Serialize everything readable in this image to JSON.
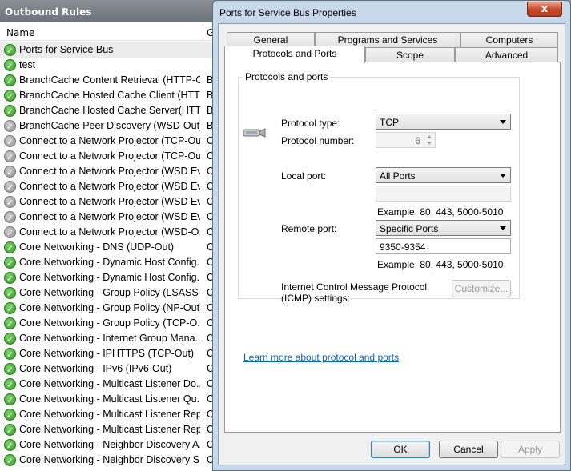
{
  "background": {
    "header_title": "Outbound Rules",
    "columns": {
      "name": "Name",
      "group": "G"
    },
    "rows": [
      {
        "name": "Ports for Service Bus",
        "group": "",
        "enabled": true
      },
      {
        "name": "test",
        "group": "",
        "enabled": true
      },
      {
        "name": "BranchCache Content Retrieval (HTTP-O...",
        "group": "B",
        "enabled": true
      },
      {
        "name": "BranchCache Hosted Cache Client (HTTT...",
        "group": "B",
        "enabled": true
      },
      {
        "name": "BranchCache Hosted Cache Server(HTTP...",
        "group": "B",
        "enabled": true
      },
      {
        "name": "BranchCache Peer Discovery (WSD-Out)",
        "group": "B",
        "enabled": false
      },
      {
        "name": "Connect to a Network Projector (TCP-Out)",
        "group": "C",
        "enabled": false
      },
      {
        "name": "Connect to a Network Projector (TCP-Out)",
        "group": "C",
        "enabled": false
      },
      {
        "name": "Connect to a Network Projector (WSD Ev...",
        "group": "C",
        "enabled": false
      },
      {
        "name": "Connect to a Network Projector (WSD Ev...",
        "group": "C",
        "enabled": false
      },
      {
        "name": "Connect to a Network Projector (WSD Ev...",
        "group": "C",
        "enabled": false
      },
      {
        "name": "Connect to a Network Projector (WSD Ev...",
        "group": "C",
        "enabled": false
      },
      {
        "name": "Connect to a Network Projector (WSD-O...",
        "group": "C",
        "enabled": false
      },
      {
        "name": "Core Networking - DNS (UDP-Out)",
        "group": "C",
        "enabled": true
      },
      {
        "name": "Core Networking - Dynamic Host Config...",
        "group": "C",
        "enabled": true
      },
      {
        "name": "Core Networking - Dynamic Host Config...",
        "group": "C",
        "enabled": true
      },
      {
        "name": "Core Networking - Group Policy (LSASS-...",
        "group": "C",
        "enabled": true
      },
      {
        "name": "Core Networking - Group Policy (NP-Out)",
        "group": "C",
        "enabled": true
      },
      {
        "name": "Core Networking - Group Policy (TCP-O...",
        "group": "C",
        "enabled": true
      },
      {
        "name": "Core Networking - Internet Group Mana...",
        "group": "C",
        "enabled": true
      },
      {
        "name": "Core Networking - IPHTTPS (TCP-Out)",
        "group": "C",
        "enabled": true
      },
      {
        "name": "Core Networking - IPv6 (IPv6-Out)",
        "group": "C",
        "enabled": true
      },
      {
        "name": "Core Networking - Multicast Listener Do...",
        "group": "C",
        "enabled": true
      },
      {
        "name": "Core Networking - Multicast Listener Qu...",
        "group": "C",
        "enabled": true
      },
      {
        "name": "Core Networking - Multicast Listener Rep...",
        "group": "C",
        "enabled": true
      },
      {
        "name": "Core Networking - Multicast Listener Rep...",
        "group": "C",
        "enabled": true
      },
      {
        "name": "Core Networking - Neighbor Discovery A...",
        "group": "C",
        "enabled": true
      },
      {
        "name": "Core Networking - Neighbor Discovery S...",
        "group": "C",
        "enabled": true
      }
    ]
  },
  "dialog": {
    "title": "Ports for Service Bus Properties",
    "close_label": "x",
    "tabs_back": [
      "General",
      "Programs and Services",
      "Computers"
    ],
    "tabs_front": [
      "Protocols and Ports",
      "Scope",
      "Advanced"
    ],
    "group_title": "Protocols and ports",
    "protocol_type_label": "Protocol type:",
    "protocol_type_value": "TCP",
    "protocol_number_label": "Protocol number:",
    "protocol_number_value": "6",
    "local_port_label": "Local port:",
    "local_port_value": "All Ports",
    "local_port_text": "",
    "example_local": "Example: 80, 443, 5000-5010",
    "remote_port_label": "Remote port:",
    "remote_port_value": "Specific Ports",
    "remote_port_text": "9350-9354",
    "example_remote": "Example: 80, 443, 5000-5010",
    "icmp_label_1": "Internet Control Message Protocol",
    "icmp_label_2": "(ICMP) settings:",
    "customize_label": "Customize...",
    "learn_more": "Learn more about protocol and ports",
    "ok_label": "OK",
    "cancel_label": "Cancel",
    "apply_label": "Apply"
  },
  "colors": {
    "enabled_icon": "#2f9b23",
    "disabled_icon": "#8c8c8c",
    "dialog_frame": "#c9d9ec",
    "close_button": "#c74a2b",
    "link": "#0066cc"
  }
}
